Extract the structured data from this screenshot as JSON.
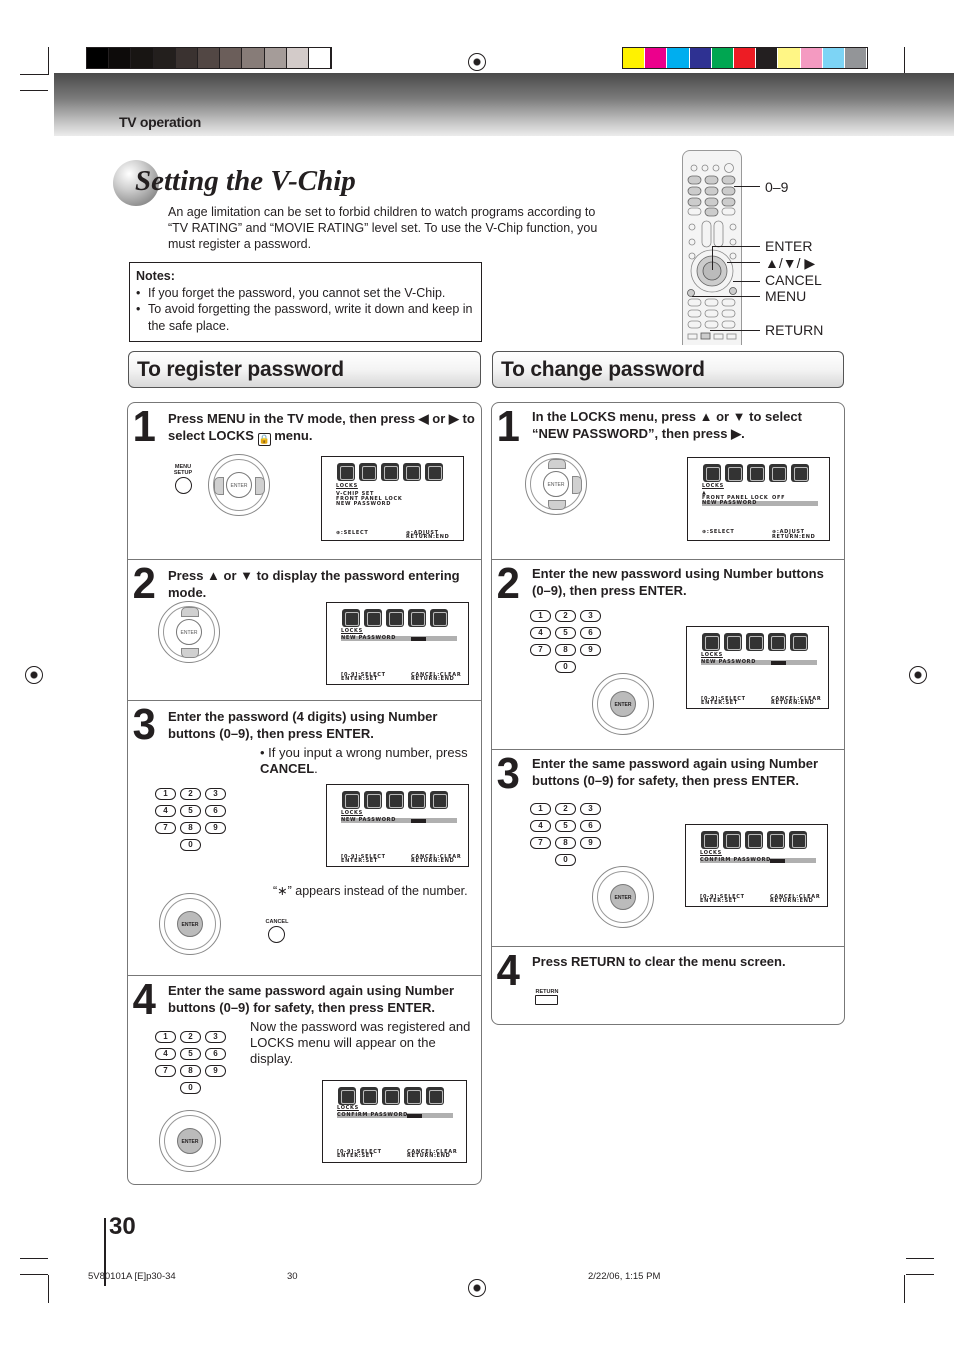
{
  "color_bar": {
    "grays": [
      "#000000",
      "#0d0b0a",
      "#181513",
      "#231f1d",
      "#3a3230",
      "#524744",
      "#6b5e5a",
      "#877c78",
      "#a59c99",
      "#d3cbc9",
      "#ffffff"
    ],
    "colors": [
      "#fff200",
      "#ec008c",
      "#00aeef",
      "#2e3192",
      "#00a651",
      "#ed1c24",
      "#231f20",
      "#fff685",
      "#f49ac1",
      "#7dd4f5",
      "#939598"
    ]
  },
  "header": {
    "section": "TV operation"
  },
  "title": "Setting the V-Chip",
  "intro": "An age limitation can be set to forbid children to watch programs according to “TV RATING” and “MOVIE RATING” level set. To use the V-Chip function, you must register a password.",
  "notes": {
    "title": "Notes:",
    "items": [
      "If you forget the password, you cannot set the V-Chip.",
      "To avoid forgetting the password, write it down and keep in the safe place."
    ]
  },
  "remote": {
    "labels": [
      "0–9",
      "ENTER",
      "▲/▼/ ▶",
      "CANCEL",
      "MENU",
      "RETURN"
    ]
  },
  "register": {
    "heading": "To register password",
    "steps": [
      {
        "num": "1",
        "text": "Press MENU in the TV mode, then press ◀ or ▶ to select LOCKS ",
        "text_end": " menu.",
        "button_label": "MENU SETUP"
      },
      {
        "num": "2",
        "text": "Press ▲ or ▼ to display the password entering mode."
      },
      {
        "num": "3",
        "text": "Enter the password (4 digits) using Number buttons (0–9), then press ENTER.",
        "note_prefix": "• If you input a wrong number, press ",
        "note_bold": "CANCEL",
        "note_suffix": ".",
        "asterisk_note": "“∗” appears instead of the number.",
        "button_label": "CANCEL"
      },
      {
        "num": "4",
        "text": "Enter the same password again using Number buttons (0–9) for safety, then press ENTER.",
        "note": "Now the password was registered and LOCKS menu will appear on the display."
      }
    ]
  },
  "change": {
    "heading": "To change password",
    "steps": [
      {
        "num": "1",
        "text": "In the LOCKS menu, press ▲ or ▼ to select “NEW PASSWORD”, then press ▶."
      },
      {
        "num": "2",
        "text": "Enter the new password using Number buttons (0–9), then press ENTER."
      },
      {
        "num": "3",
        "text": "Enter the same password again using Number buttons (0–9) for safety, then press ENTER."
      },
      {
        "num": "4",
        "text": "Press RETURN to clear the menu screen.",
        "button_label": "RETURN"
      }
    ]
  },
  "screens": {
    "menu_title": "LOCKS",
    "s1_lines": [
      "V-CHIP SET",
      "FRONT PANEL LOCK",
      "NEW PASSWORD"
    ],
    "s1_foot_left": "⊕:SELECT",
    "s1_foot_right1": "⊕:ADJUST",
    "s1_foot_right2": "RETURN:END",
    "front_panel_lock": "FRONT PANEL LOCK",
    "off": "OFF",
    "new_password": "NEW PASSWORD",
    "confirm_password": "CONFIRM PASSWORD",
    "pw_foot_left1": "[0-9]:SELECT",
    "pw_foot_left2": "ENTER:SET",
    "pw_foot_right1": "CANCEL:CLEAR",
    "pw_foot_right2": "RETURN:END"
  },
  "numpad_keys": [
    "1",
    "2",
    "3",
    "4",
    "5",
    "6",
    "7",
    "8",
    "9",
    "0"
  ],
  "dpad_center": "ENTER",
  "footer": {
    "page_number": "30",
    "file": "5V80101A [E]p30-34",
    "page": "30",
    "date": "2/22/06, 1:15 PM"
  }
}
